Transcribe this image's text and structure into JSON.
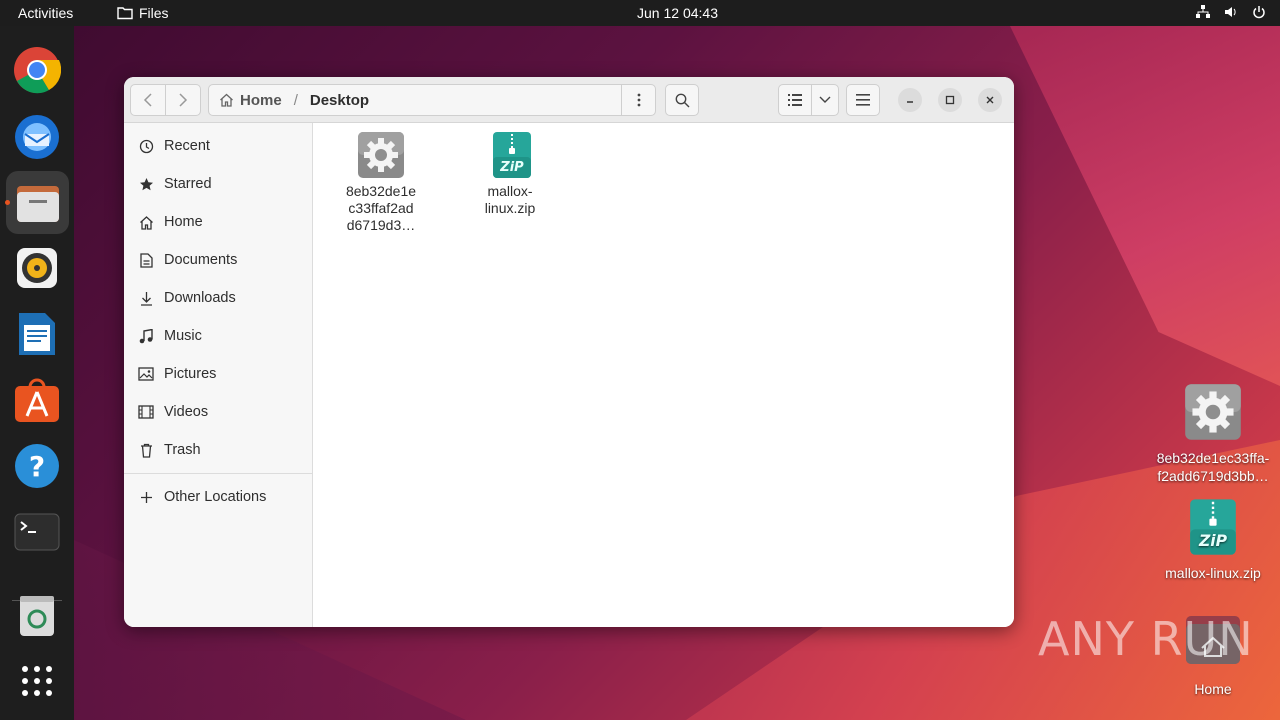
{
  "topbar": {
    "activities": "Activities",
    "app_name": "Files",
    "clock": "Jun 12  04:43",
    "tray_icons": [
      "network-icon",
      "volume-icon",
      "power-icon"
    ]
  },
  "dock": {
    "items": [
      {
        "name": "chrome-icon",
        "active": false
      },
      {
        "name": "thunderbird-icon",
        "active": false
      },
      {
        "name": "files-icon",
        "active": true
      },
      {
        "name": "rhythmbox-icon",
        "active": false
      },
      {
        "name": "libreoffice-writer-icon",
        "active": false
      },
      {
        "name": "app-center-icon",
        "active": false
      },
      {
        "name": "help-icon",
        "active": false
      },
      {
        "name": "terminal-icon",
        "active": false
      },
      {
        "name": "trash-icon",
        "active": false
      },
      {
        "name": "show-apps-icon",
        "active": false
      }
    ]
  },
  "window": {
    "pathbar": {
      "home_label": "Home",
      "separator": "/",
      "current": "Desktop"
    },
    "sidebar": {
      "items": [
        {
          "label": "Recent",
          "icon": "clock-icon"
        },
        {
          "label": "Starred",
          "icon": "star-icon"
        },
        {
          "label": "Home",
          "icon": "home-icon"
        },
        {
          "label": "Documents",
          "icon": "document-icon"
        },
        {
          "label": "Downloads",
          "icon": "download-icon"
        },
        {
          "label": "Music",
          "icon": "music-icon"
        },
        {
          "label": "Pictures",
          "icon": "picture-icon"
        },
        {
          "label": "Videos",
          "icon": "video-icon"
        },
        {
          "label": "Trash",
          "icon": "trash-icon"
        }
      ],
      "other_locations": "Other Locations"
    },
    "files": [
      {
        "name": "8eb32de1e\nc33ffaf2ad\nd6719d3…",
        "icon": "executable-gear-icon"
      },
      {
        "name": "mallox-\nlinux.zip",
        "icon": "zip-archive-icon"
      }
    ]
  },
  "desktop": {
    "icons": [
      {
        "name": "8eb32de1ec33ffa-\nf2add6719d3bb…",
        "icon": "executable-gear-icon"
      },
      {
        "name": "mallox-linux.zip",
        "icon": "zip-archive-icon"
      },
      {
        "name": "Home",
        "icon": "home-folder-icon"
      }
    ]
  },
  "watermark": "ANY RUN",
  "colors": {
    "accent": "#e95420",
    "zip_teal": "#26a69a",
    "topbar": "#1d1d1d"
  }
}
